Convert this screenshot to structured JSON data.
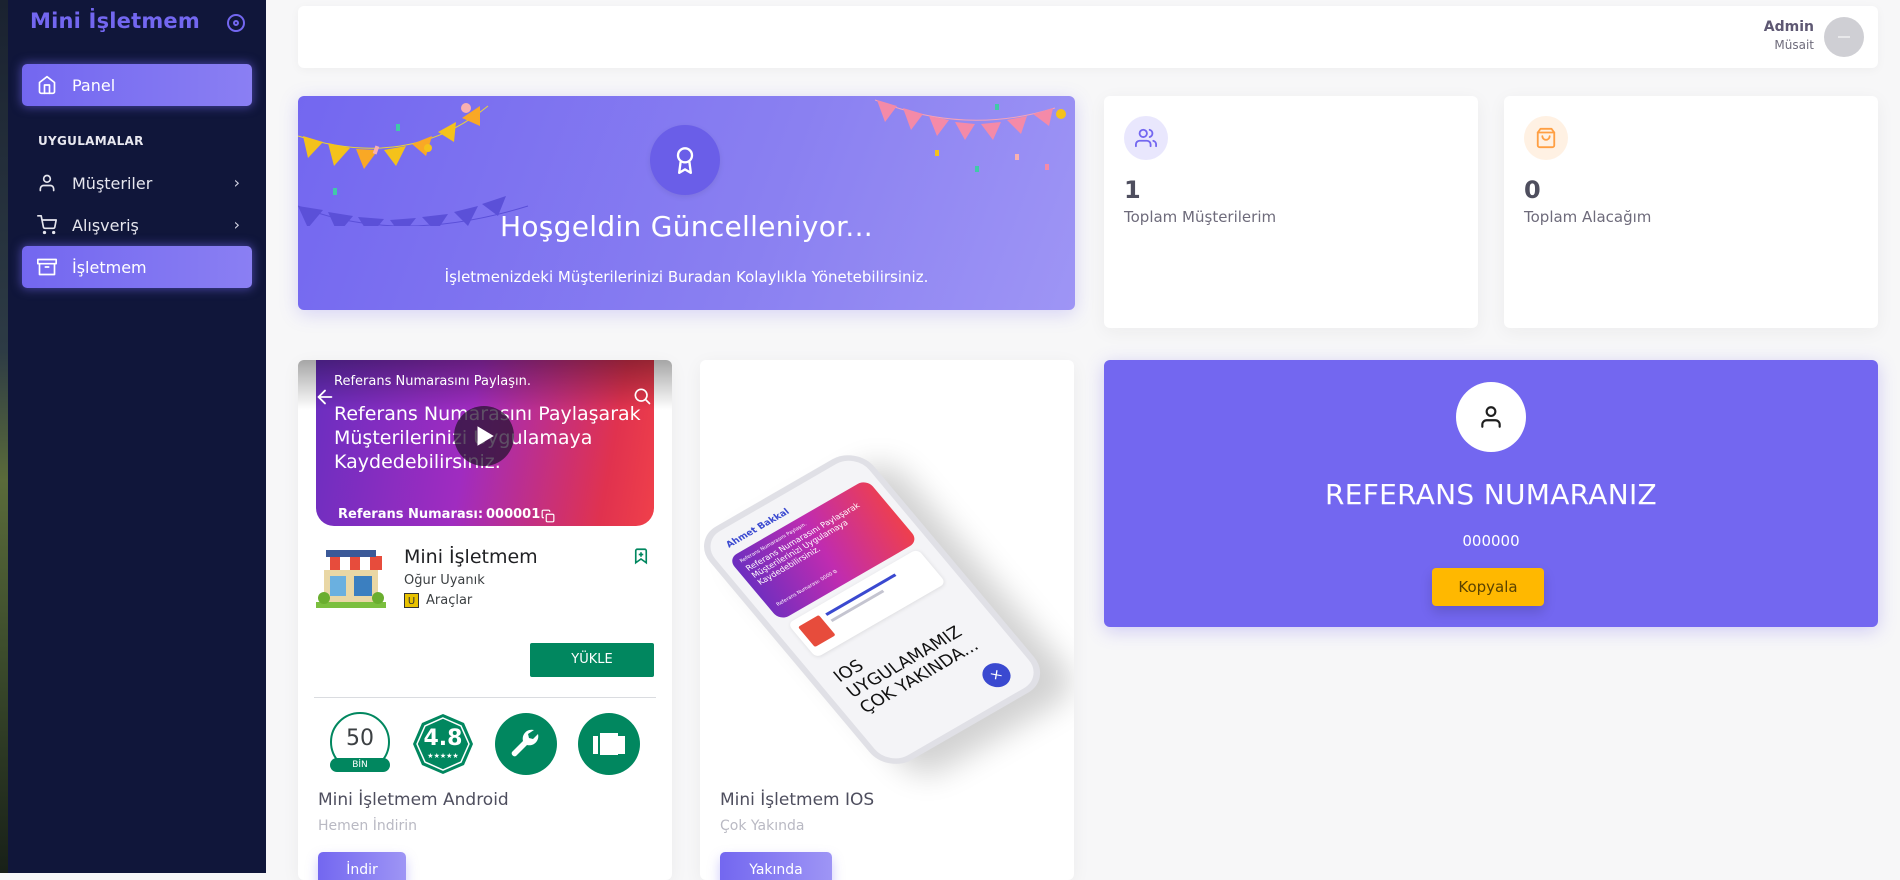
{
  "sidebar": {
    "brand": "Mini İşletmem",
    "items": [
      {
        "label": "Panel"
      },
      {
        "label": "Müşteriler"
      },
      {
        "label": "Alışveriş"
      },
      {
        "label": "İşletmem"
      }
    ],
    "section_title": "UYGULAMALAR"
  },
  "header": {
    "user_name": "Admin",
    "user_status": "Müsait"
  },
  "welcome": {
    "title": "Hoşgeldin Güncelleniyor...",
    "text": "İşletmenizdeki Müşterilerinizi Buradan Kolaylıkla Yönetebilirsiniz."
  },
  "stats": [
    {
      "value": "1",
      "label": "Toplam Müşterilerim",
      "icon": "users-icon",
      "color": "#7367f0"
    },
    {
      "value": "0",
      "label": "Toplam Alacağım",
      "icon": "shopping-bag-icon",
      "color": "#ff9f43"
    }
  ],
  "android": {
    "banner_small": "Referans Numarasını Paylaşın.",
    "banner_big": "Referans Numarasını Paylaşarak Müşterilerinizi Uygulamaya Kaydedebilirsiniz.",
    "ref_label": "Referans Numarası:",
    "ref_number": "000001",
    "app_name": "Mini İşletmem",
    "developer": "Oğur Uyanık",
    "category_badge": "U",
    "category": "Araçlar",
    "install": "YÜKLE",
    "downloads": "50",
    "downloads_unit": "BİN",
    "rating": "4.8",
    "rating_stars": "★★★★★",
    "title": "Mini İşletmem Android",
    "subtitle": "Hemen İndirin",
    "button": "İndir"
  },
  "ios": {
    "title": "Mini İşletmem IOS",
    "subtitle": "Çok Yakında",
    "button": "Yakında",
    "phone_header": "Ahmet Bakkal",
    "phone_card_small": "Referans Numarasını Paylaşın.",
    "phone_card_big": "Referans Numarasını Paylaşarak Müşterilerinizi Uygulamaya Kaydedebilirsiniz.",
    "phone_ref": "Referans Numarası:   0000  ⧉",
    "phone_banner_line1": "IOS",
    "phone_banner_line2": "UYGULAMAMIZ",
    "phone_banner_line3": "ÇOK YAKINDA...",
    "phone_fab": "×"
  },
  "referans": {
    "title": "REFERANS NUMARANIZ",
    "number": "000000",
    "button": "Kopyala"
  },
  "colors": {
    "primary": "#7367f0",
    "sidebar": "#10163a",
    "warning": "#ffb800",
    "playstore_green": "#01875f"
  }
}
